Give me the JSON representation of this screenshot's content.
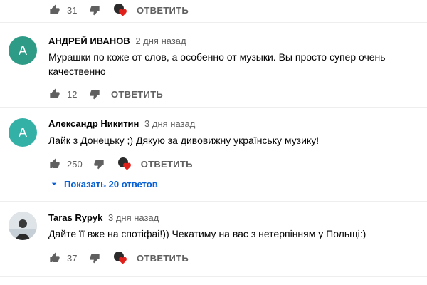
{
  "colors": {
    "avatar_teal": "#2e9b86",
    "avatar_cyan": "#34b1a6",
    "heart": "#e0201a",
    "link": "#065fd4"
  },
  "top_actions": {
    "like_count": "31",
    "reply_label": "ОТВЕТИТЬ"
  },
  "comments": [
    {
      "avatar_letter": "А",
      "author": "АНДРЕЙ ИВАНОВ",
      "time": "2 дня назад",
      "text": "Мурашки по коже от слов, а особенно от музыки. Вы просто супер очень качественно",
      "like_count": "12",
      "reply_label": "ОТВЕТИТЬ"
    },
    {
      "avatar_letter": "А",
      "author": "Александр Никитин",
      "time": "3 дня назад",
      "text": "Лайк з Донецьку ;) Дякую за дивовижну українську музику!",
      "like_count": "250",
      "reply_label": "ОТВЕТИТЬ",
      "show_replies": "Показать 20 ответов"
    },
    {
      "avatar_letter": "",
      "author": "Taras Rypyk",
      "time": "3 дня назад",
      "text": "Дайте її вже на спотіфаі!)) Чекатиму на вас з нетерпінням у Польщі:)",
      "like_count": "37",
      "reply_label": "ОТВЕТИТЬ"
    }
  ]
}
